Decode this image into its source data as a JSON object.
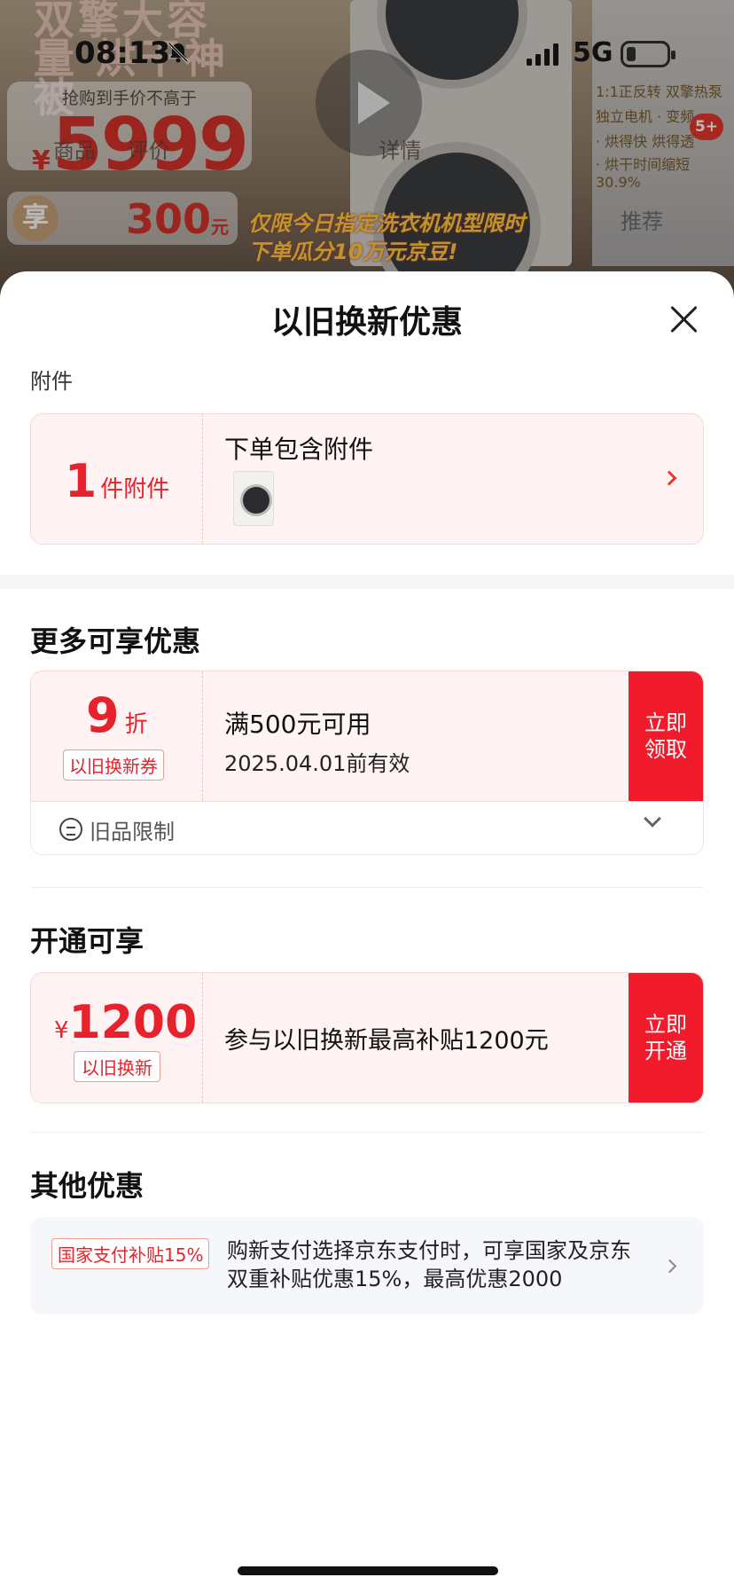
{
  "background_page": {
    "hero_text": "双擎大容量 烘干神被",
    "price_caption": "抢购到手价不高于",
    "price_currency": "¥",
    "price_value": "5999",
    "nav_tabs": [
      "商品",
      "评价",
      "详情"
    ],
    "subsidy_icon": "享",
    "subsidy_amount": "300",
    "subsidy_unit": "元",
    "banner_line1": "仅限今日指定洗衣机机型限时",
    "banner_line2": "下单瓜分10万元京豆!",
    "right_lines": [
      "1:1正反转 双擎热泵",
      "独立电机 · 变频",
      "· 烘得快 烘得透",
      "· 烘干时间缩短30.9%"
    ],
    "badge": "5+",
    "recommend": "推荐"
  },
  "status_bar": {
    "time": "08:13",
    "network": "5G"
  },
  "sheet": {
    "title": "以旧换新优惠",
    "accessory": {
      "section_label": "附件",
      "count": "1",
      "count_unit": "件附件",
      "title": "下单包含附件"
    },
    "more_offers": {
      "section_title": "更多可享优惠",
      "coupon_value": "9",
      "coupon_unit": "折",
      "coupon_tag": "以旧换新券",
      "coupon_condition": "满500元可用",
      "coupon_expiry": "2025.04.01前有效",
      "claim_label_line1": "立即",
      "claim_label_line2": "领取",
      "limit_text": "旧品限制"
    },
    "activate": {
      "section_title": "开通可享",
      "currency": "¥",
      "amount": "1200",
      "tag": "以旧换新",
      "description": "参与以旧换新最高补贴1200元",
      "button_line1": "立即",
      "button_line2": "开通"
    },
    "other": {
      "section_title": "其他优惠",
      "tag": "国家支付补贴15%",
      "description": "购新支付选择京东支付时，可享国家及京东双重补贴优惠15%，最高优惠2000"
    }
  },
  "colors": {
    "accent_red": "#e8222c",
    "button_red": "#f21b2b",
    "card_bg": "#fff4f3"
  }
}
